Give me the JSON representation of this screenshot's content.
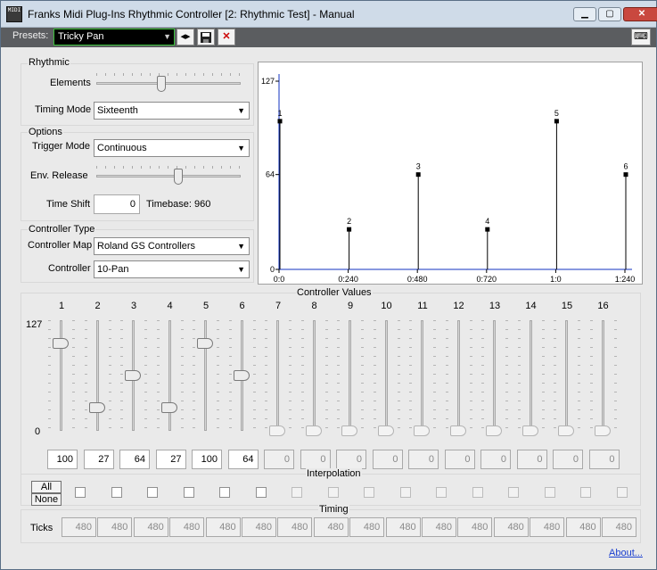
{
  "window": {
    "icon_text": "MIDI",
    "title": "Franks Midi Plug-Ins Rhythmic Controller [2: Rhythmic Test] - Manual",
    "minimize": "▁",
    "maximize": "▢",
    "close": "✕"
  },
  "presets": {
    "label": "Presets:",
    "value": "Tricky Pan",
    "prevnext": "◂▸",
    "save": "💾",
    "delete": "✕",
    "keyboard": "⌨"
  },
  "rhythmic": {
    "title": "Rhythmic",
    "elements_label": "Elements",
    "elements_level": 0.45,
    "timing_mode_label": "Timing Mode",
    "timing_mode_value": "Sixteenth"
  },
  "options": {
    "title": "Options",
    "trigger_mode_label": "Trigger Mode",
    "trigger_mode_value": "Continuous",
    "env_release_label": "Env. Release",
    "env_release_level": 0.57,
    "time_shift_label": "Time Shift",
    "time_shift_value": "0",
    "timebase": "Timebase: 960"
  },
  "controller_type": {
    "title": "Controller Type",
    "map_label": "Controller Map",
    "map_value": "Roland GS Controllers",
    "controller_label": "Controller",
    "controller_value": "10-Pan"
  },
  "chart_data": {
    "type": "bar",
    "x_tick_labels": [
      "0:0",
      "0:240",
      "0:480",
      "0:720",
      "1:0",
      "1:240"
    ],
    "y_tick_labels": [
      "127",
      "64",
      "0"
    ],
    "ylim": [
      0,
      127
    ],
    "points": [
      {
        "label": "1",
        "value": 100
      },
      {
        "label": "2",
        "value": 27
      },
      {
        "label": "3",
        "value": 64
      },
      {
        "label": "4",
        "value": 27
      },
      {
        "label": "5",
        "value": 100
      },
      {
        "label": "6",
        "value": 64
      }
    ]
  },
  "controller_values": {
    "title": "Controller Values",
    "max_label": "127",
    "min_label": "0",
    "columns": [
      "1",
      "2",
      "3",
      "4",
      "5",
      "6",
      "7",
      "8",
      "9",
      "10",
      "11",
      "12",
      "13",
      "14",
      "15",
      "16"
    ],
    "values": [
      "100",
      "27",
      "64",
      "27",
      "100",
      "64",
      "0",
      "0",
      "0",
      "0",
      "0",
      "0",
      "0",
      "0",
      "0",
      "0"
    ],
    "active_count": 6
  },
  "interpolation": {
    "title": "Interpolation",
    "all": "All",
    "none": "None"
  },
  "timing": {
    "title": "Timing",
    "ticks_label": "Ticks",
    "values": [
      "480",
      "480",
      "480",
      "480",
      "480",
      "480",
      "480",
      "480",
      "480",
      "480",
      "480",
      "480",
      "480",
      "480",
      "480",
      "480"
    ]
  },
  "about": "About..."
}
